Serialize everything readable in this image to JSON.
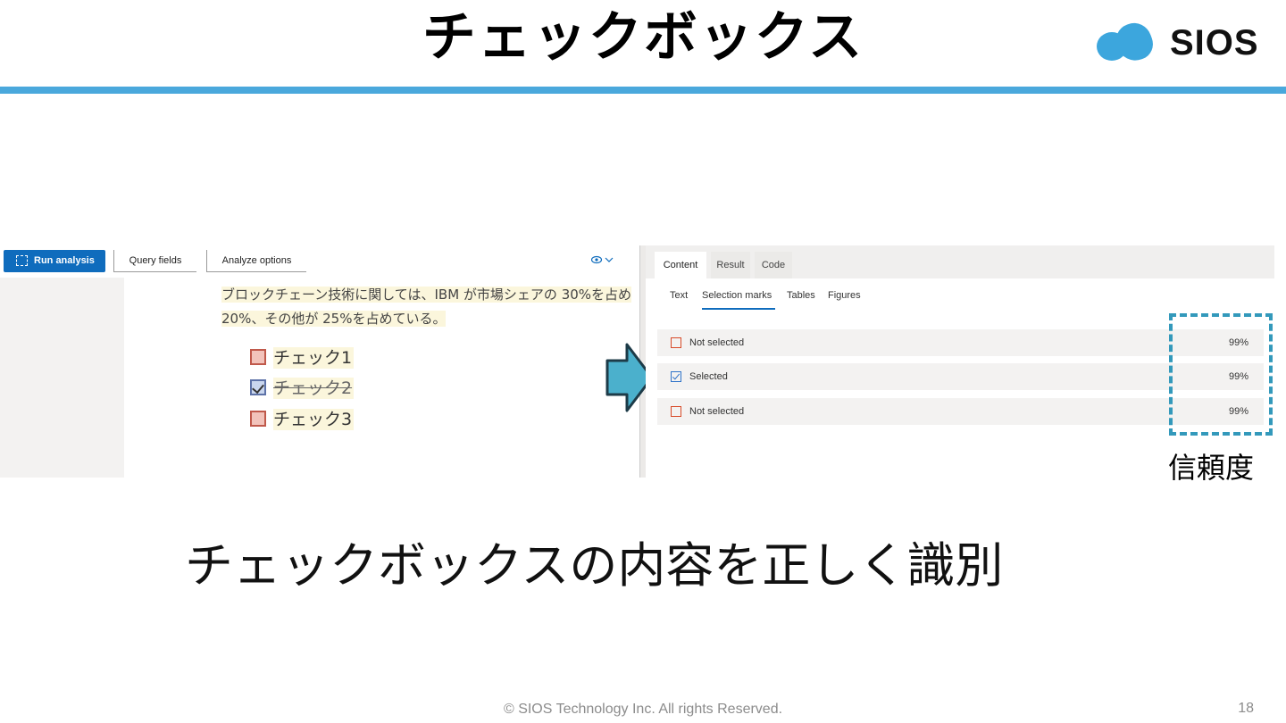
{
  "slide": {
    "title": "チェックボックス",
    "subtitle": "チェックボックスの内容を正しく識別",
    "confidence_label": "信頼度",
    "copyright": "© SIOS Technology Inc. All rights Reserved.",
    "page_number": "18"
  },
  "logo": {
    "text": "SIOS",
    "color": "#3ca6dd"
  },
  "colors": {
    "accent": "#4aa8dc",
    "primary_button": "#0f6cbd",
    "highlight_dash": "#3399bb"
  },
  "toolbar": {
    "run_label": "Run analysis",
    "query_label": "Query fields",
    "options_label": "Analyze options",
    "view_icon": "eye-icon"
  },
  "document": {
    "line1": "ブロックチェーン技術に関しては、IBM が市場シェアの 30%を占め",
    "line2": "20%、その他が 25%を占めている。",
    "checkboxes": [
      {
        "label": "チェック1",
        "checked": false
      },
      {
        "label": "チェック2",
        "checked": true
      },
      {
        "label": "チェック3",
        "checked": false
      }
    ]
  },
  "results": {
    "tabs": [
      "Content",
      "Result",
      "Code"
    ],
    "subtabs": [
      "Text",
      "Selection marks",
      "Tables",
      "Figures"
    ],
    "active_subtab": "Selection marks",
    "rows": [
      {
        "state": "Not selected",
        "confidence": "99%"
      },
      {
        "state": "Selected",
        "confidence": "99%"
      },
      {
        "state": "Not selected",
        "confidence": "99%"
      }
    ]
  }
}
